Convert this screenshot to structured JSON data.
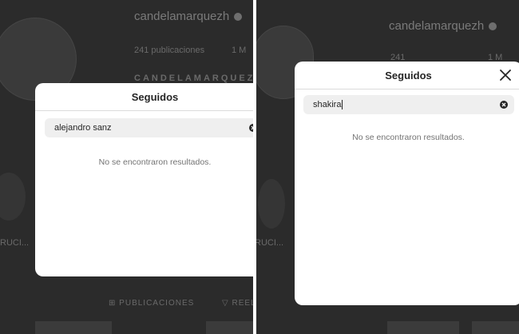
{
  "profile": {
    "username": "candelamarquezh",
    "posts_count": "241",
    "posts_label": "publicaciones",
    "followers_partial": "1 M",
    "display_name_partial": "CANDELAMARQUEZ",
    "story_label_partial": "RUCI...",
    "posts_tab_label": "PUBLICACIONES",
    "reels_tab_partial": "REEL"
  },
  "left_modal": {
    "title": "Seguidos",
    "search_value": "alejandro sanz",
    "no_results": "No se encontraron resultados."
  },
  "right_modal": {
    "title": "Seguidos",
    "search_value": "shakira",
    "no_results": "No se encontraron resultados."
  }
}
